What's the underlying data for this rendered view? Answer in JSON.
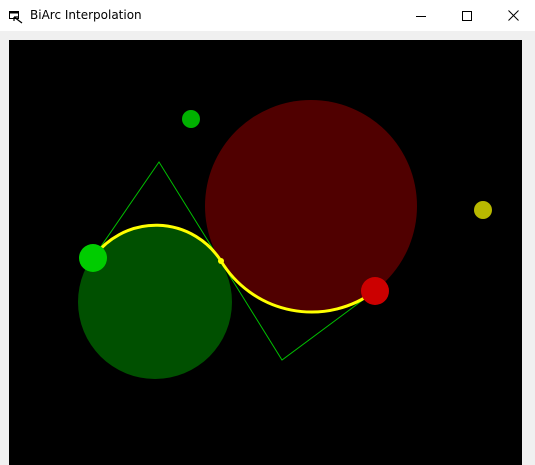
{
  "window": {
    "title": "BiArc Interpolation",
    "controls": {
      "minimize": "minimize-icon",
      "maximize": "maximize-icon",
      "close": "close-icon"
    }
  },
  "colors": {
    "titlebar_bg": "#ffffff",
    "client_bg": "#f0f0f0",
    "canvas_bg": "#000000",
    "circle_left_fill": "#005000",
    "circle_right_fill": "#500000",
    "biarc_stroke": "#ffff00",
    "control_polygon_stroke": "#00c000",
    "start_point": "#00cc00",
    "end_point": "#cc0000",
    "handle_green": "#00b000",
    "handle_yellow": "#b8b800"
  }
}
